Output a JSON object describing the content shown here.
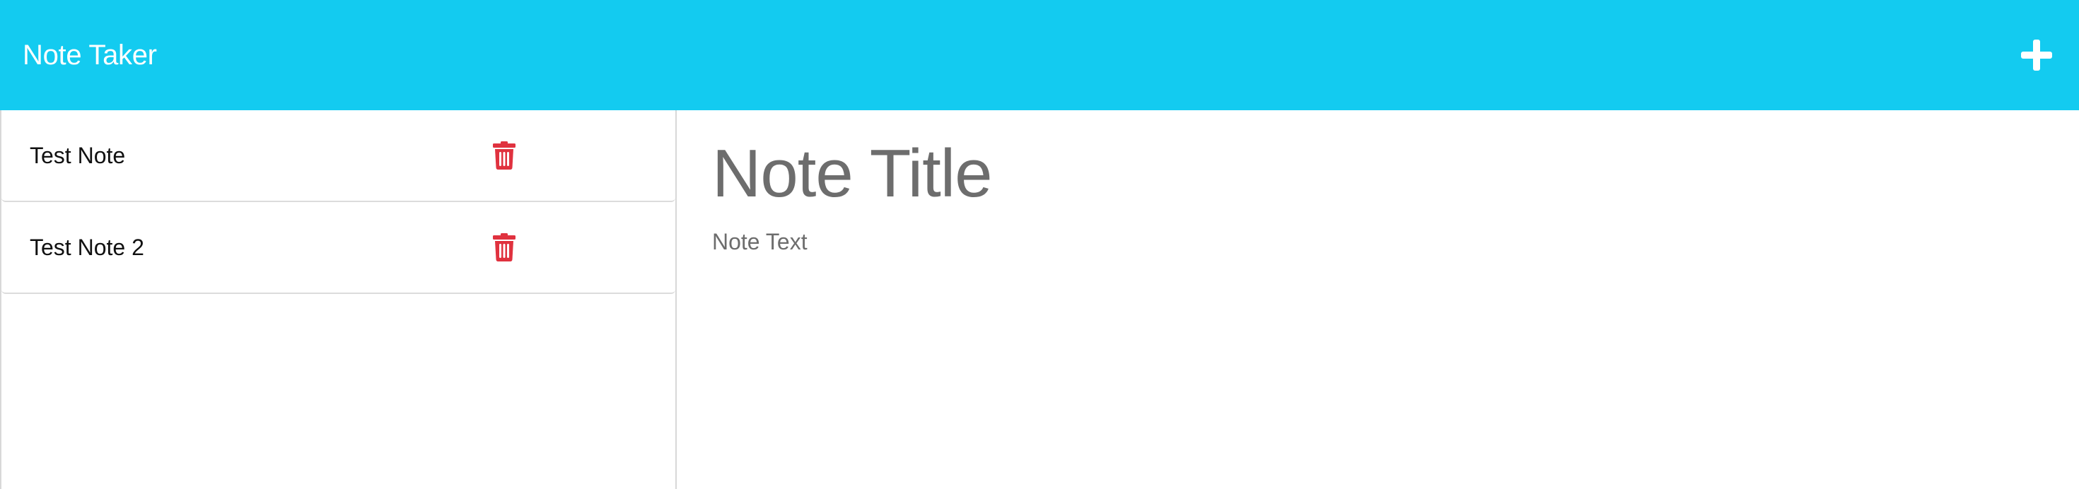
{
  "navbar": {
    "brand": "Note Taker",
    "add_icon": "plus-icon",
    "background_color": "#13cbf0"
  },
  "sidebar": {
    "notes": [
      {
        "title": "Test Note",
        "delete_icon": "trash-icon"
      },
      {
        "title": "Test Note 2",
        "delete_icon": "trash-icon"
      }
    ],
    "delete_color": "#e0323f"
  },
  "editor": {
    "title_placeholder": "Note Title",
    "text_placeholder": "Note Text"
  }
}
